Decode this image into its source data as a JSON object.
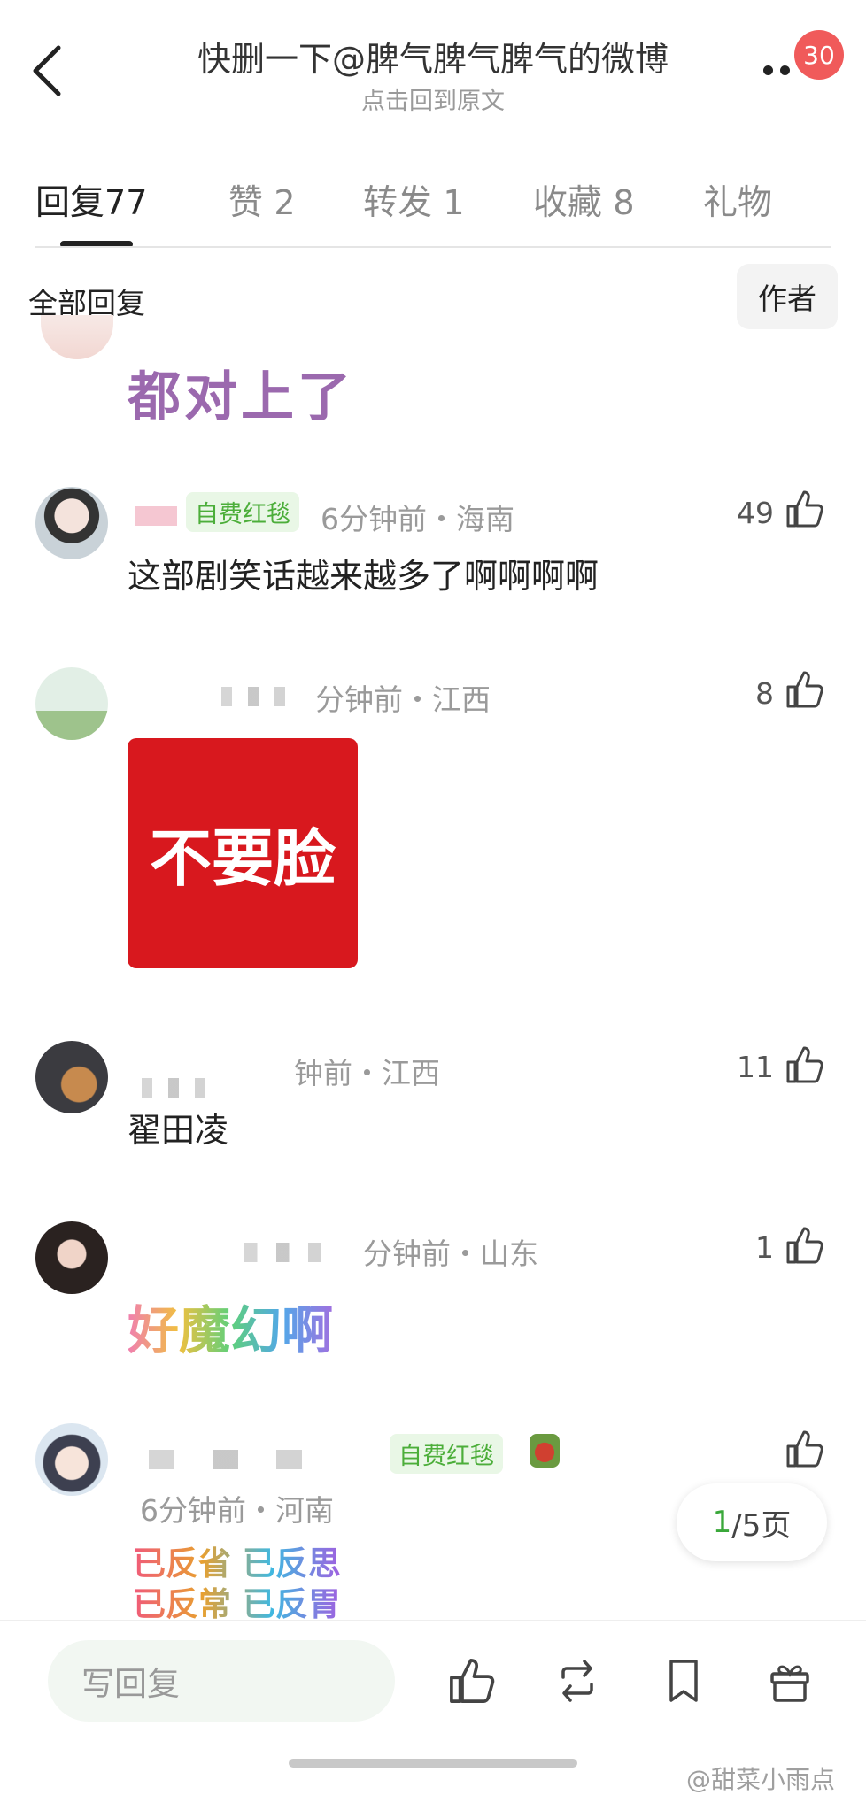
{
  "header": {
    "title": "快删一下@脾气脾气脾气的微博",
    "subtitle": "点击回到原文",
    "badge_count": "30"
  },
  "tabs": [
    {
      "label": "回复",
      "count": "77"
    },
    {
      "label": "赞",
      "count": "2"
    },
    {
      "label": "转发",
      "count": "1"
    },
    {
      "label": "收藏",
      "count": "8"
    },
    {
      "label": "礼物",
      "count": ""
    }
  ],
  "filter": {
    "label": "全部回复",
    "author_button": "作者"
  },
  "comments": [
    {
      "sticker_text": "都对上了"
    },
    {
      "tag": "自费红毯",
      "meta": "6分钟前・海南",
      "likes": "49",
      "text": "这部剧笑话越来越多了啊啊啊啊"
    },
    {
      "meta": "分钟前・江西",
      "likes": "8",
      "sticker_text": "不要脸"
    },
    {
      "meta": "钟前・江西",
      "likes": "11",
      "text": "翟田凌"
    },
    {
      "meta": "分钟前・山东",
      "likes": "1",
      "sticker_text": "好魔幻啊"
    },
    {
      "tag": "自费红毯",
      "meta": "6分钟前・河南",
      "likes": "",
      "sticker_lines": [
        "已反省 已反思",
        "已反常 已反胃"
      ]
    }
  ],
  "pagination": {
    "current": "1",
    "rest": "/5页"
  },
  "bottom_bar": {
    "reply_placeholder": "写回复"
  },
  "watermark": "@甜菜小雨点",
  "colors": {
    "accent_green": "#3aa83a",
    "badge_red": "#f05a5a",
    "sticker_red": "#d8181e"
  }
}
